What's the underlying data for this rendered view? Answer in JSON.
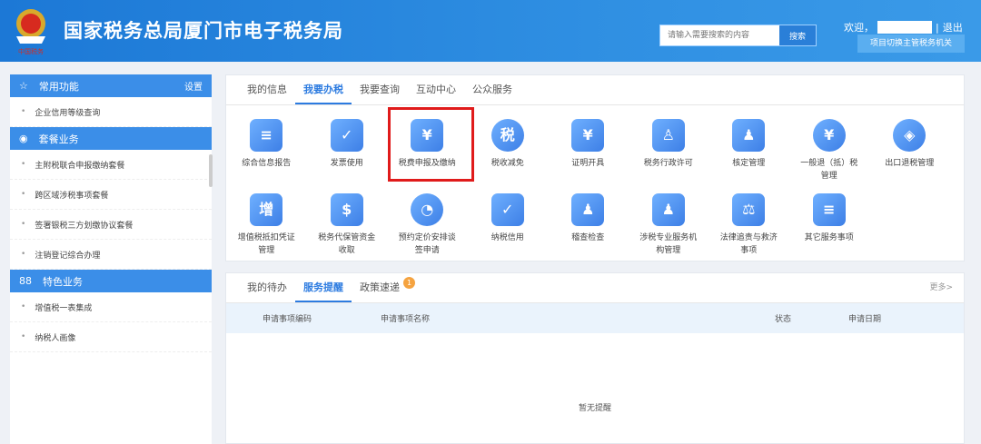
{
  "header": {
    "title": "国家税务总局厦门市电子税务局",
    "search_placeholder": "请输入需要搜索的内容",
    "search_button": "搜索",
    "welcome": "欢迎，",
    "divider": "|",
    "logout": "退出",
    "switch_button": "项目切换主管税务机关"
  },
  "sidebar": {
    "sections": [
      {
        "title": "常用功能",
        "icon": "star-icon",
        "action": "设置",
        "items": [
          "企业信用等级查询"
        ]
      },
      {
        "title": "套餐业务",
        "icon": "package-icon",
        "items": [
          "主附税联合申报缴纳套餐",
          "跨区域涉税事项套餐",
          "签署银税三方划缴协议套餐",
          "注销登记综合办理"
        ]
      },
      {
        "title": "特色业务",
        "icon": "grid-icon",
        "items": [
          "增值税一表集成",
          "纳税人画像"
        ]
      }
    ]
  },
  "main": {
    "tabs": [
      "我的信息",
      "我要办税",
      "我要查询",
      "互动中心",
      "公众服务"
    ],
    "active_tab": 1,
    "services": [
      {
        "label": "综合信息报告",
        "icon": "≡"
      },
      {
        "label": "发票使用",
        "icon": "✓"
      },
      {
        "label": "税费申报及缴纳",
        "icon": "¥"
      },
      {
        "label": "税收减免",
        "icon": "税"
      },
      {
        "label": "证明开具",
        "icon": "¥"
      },
      {
        "label": "税务行政许可",
        "icon": "♙"
      },
      {
        "label": "核定管理",
        "icon": "♟"
      },
      {
        "label": "一般退（抵）税管理",
        "icon": "¥"
      },
      {
        "label": "出口退税管理",
        "icon": "◈"
      },
      {
        "label": "增值税抵扣凭证管理",
        "icon": "增"
      },
      {
        "label": "税务代保管资金收取",
        "icon": "$"
      },
      {
        "label": "预约定价安排谈签申请",
        "icon": "◔"
      },
      {
        "label": "纳税信用",
        "icon": "✓"
      },
      {
        "label": "稽查检查",
        "icon": "♟"
      },
      {
        "label": "涉税专业服务机构管理",
        "icon": "♟"
      },
      {
        "label": "法律追责与救济事项",
        "icon": "⚖"
      },
      {
        "label": "其它服务事项",
        "icon": "≡"
      }
    ]
  },
  "notices": {
    "tabs": [
      "我的待办",
      "服务提醒",
      "政策速递"
    ],
    "active_tab": 1,
    "badge": "1",
    "more": "更多>",
    "columns": [
      "申请事项编码",
      "申请事项名称",
      "状态",
      "申请日期"
    ],
    "empty": "暂无提醒"
  }
}
